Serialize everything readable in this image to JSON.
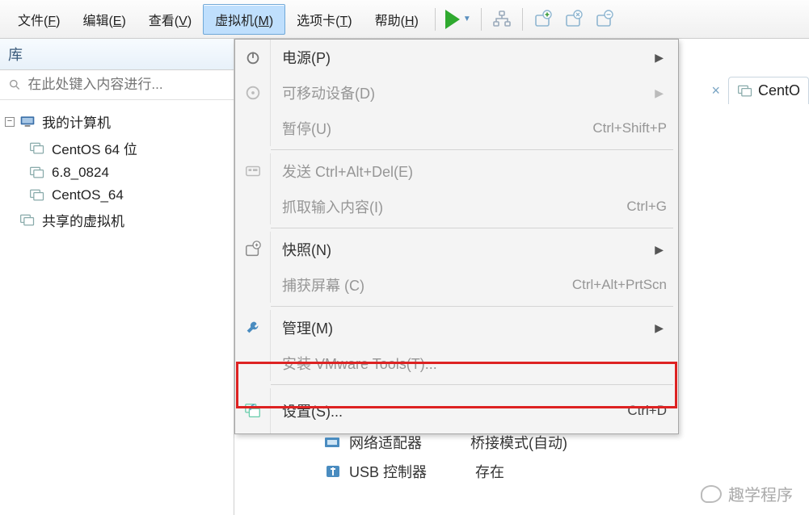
{
  "menubar": {
    "file": {
      "prefix": "文件(",
      "u": "F",
      "suffix": ")"
    },
    "edit": {
      "prefix": "编辑(",
      "u": "E",
      "suffix": ")"
    },
    "view": {
      "prefix": "查看(",
      "u": "V",
      "suffix": ")"
    },
    "vm": {
      "prefix": "虚拟机(",
      "u": "M",
      "suffix": ")"
    },
    "tabs": {
      "prefix": "选项卡(",
      "u": "T",
      "suffix": ")"
    },
    "help": {
      "prefix": "帮助(",
      "u": "H",
      "suffix": ")"
    }
  },
  "sidebar": {
    "header": "库",
    "search_placeholder": "在此处键入内容进行...",
    "tree": {
      "root": "我的计算机",
      "items": [
        "CentOS 64 位",
        "6.8_0824",
        "CentOS_64"
      ],
      "shared": "共享的虚拟机"
    }
  },
  "dropdown": {
    "power": {
      "label": "电源(P)"
    },
    "removable": {
      "label": "可移动设备(D)"
    },
    "pause": {
      "label": "暂停(U)",
      "shortcut": "Ctrl+Shift+P"
    },
    "send_cad": {
      "label": "发送 Ctrl+Alt+Del(E)"
    },
    "grab_input": {
      "label": "抓取输入内容(I)",
      "shortcut": "Ctrl+G"
    },
    "snapshot": {
      "label": "快照(N)"
    },
    "capture": {
      "label": "捕获屏幕 (C)",
      "shortcut": "Ctrl+Alt+PrtScn"
    },
    "manage": {
      "label": "管理(M)"
    },
    "tools": {
      "label": "安装 VMware Tools(T)..."
    },
    "settings": {
      "label": "设置(S)...",
      "shortcut": "Ctrl+D"
    }
  },
  "tabs_right": {
    "new_tab_label": "CentO"
  },
  "peek": {
    "net_label": "网络适配器",
    "net_value": "桥接模式(自动)",
    "usb_label": "USB 控制器",
    "usb_value": "存在"
  },
  "watermark": "趣学程序"
}
